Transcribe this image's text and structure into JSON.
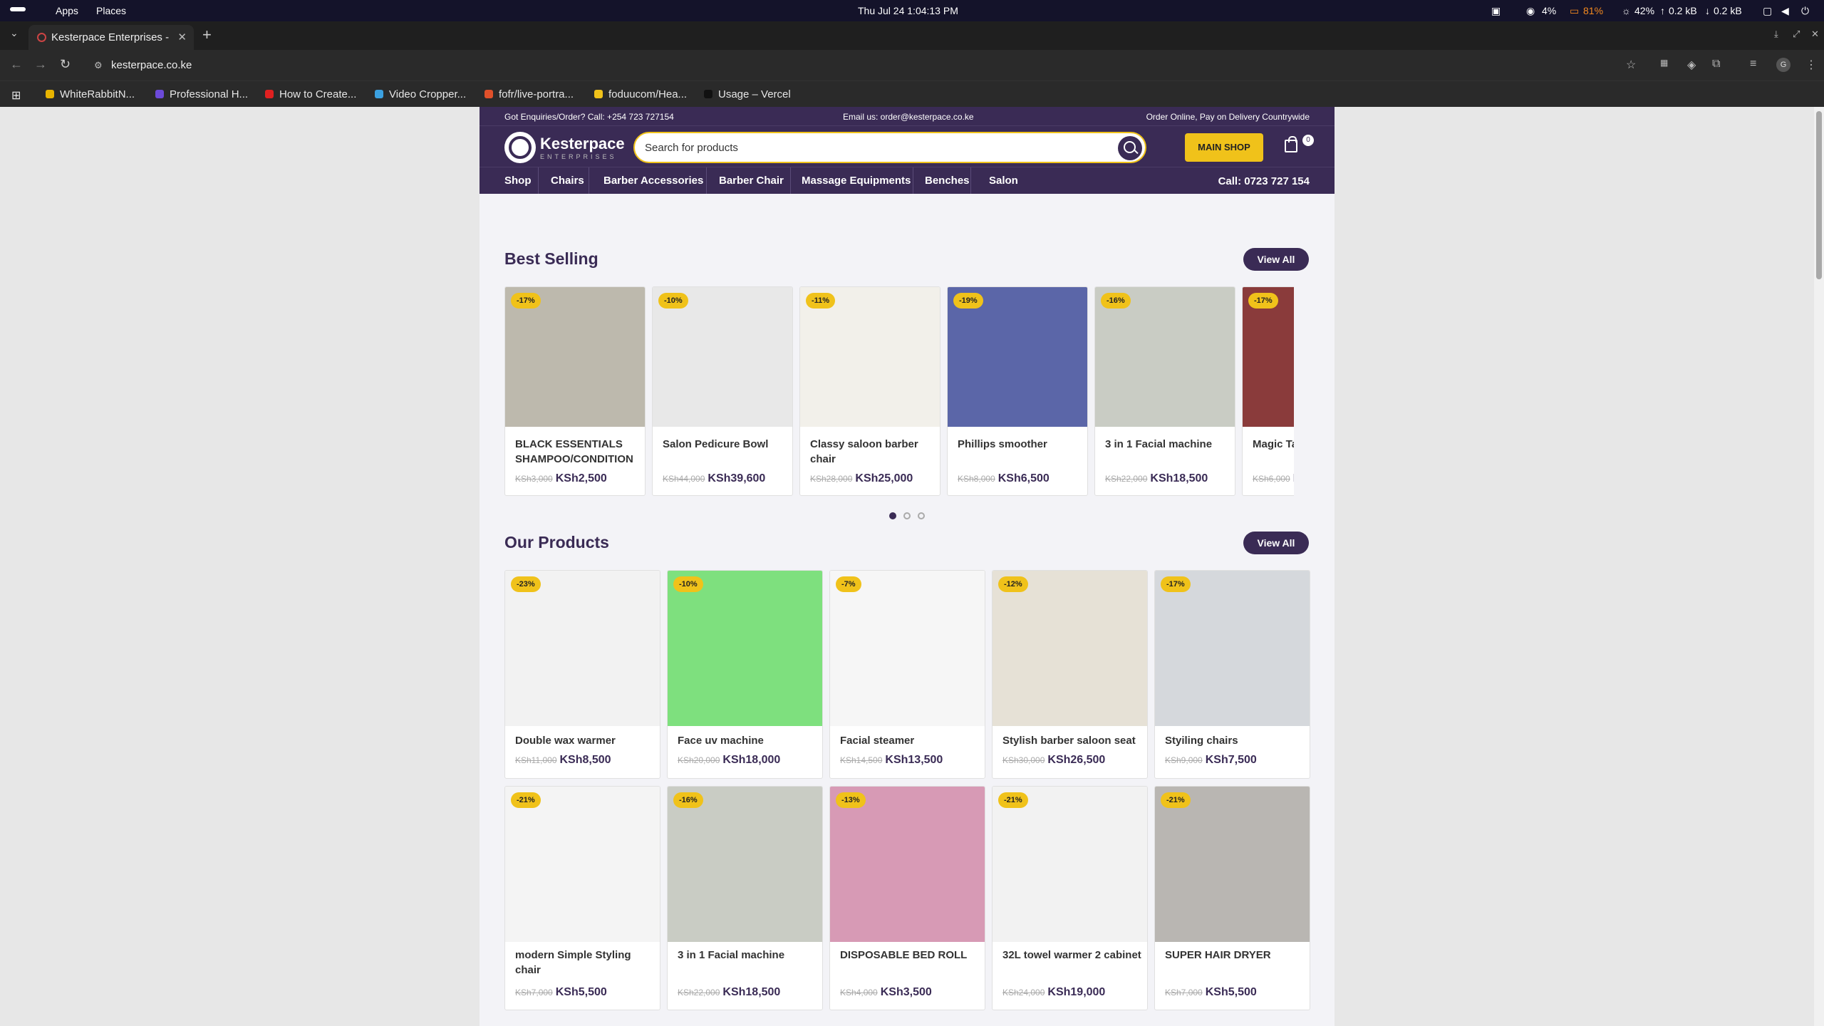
{
  "os": {
    "apps": "Apps",
    "places": "Places",
    "datetime": "Thu Jul 24   1:04:13 PM",
    "cpu": "4%",
    "battery": "81%",
    "brightness": "42%",
    "net_up": "0.2 kB",
    "net_down": "0.2 kB"
  },
  "browser": {
    "tab_title": "Kesterpace Enterprises -",
    "url": "kesterpace.co.ke",
    "avatar": "G",
    "bookmarks": [
      {
        "label": "WhiteRabbitN...",
        "color": "#e8b400"
      },
      {
        "label": "Professional H...",
        "color": "#6c4ad9"
      },
      {
        "label": "How to Create...",
        "color": "#e02020"
      },
      {
        "label": "Video Cropper...",
        "color": "#3ba0e0"
      },
      {
        "label": "fofr/live-portra...",
        "color": "#e0502a"
      },
      {
        "label": "foduucom/Hea...",
        "color": "#f0c21a"
      },
      {
        "label": "Usage – Vercel",
        "color": "#111111"
      }
    ]
  },
  "site": {
    "topbar": {
      "left": "Got Enquiries/Order? Call: +254 723 727154",
      "center": "Email us: order@kesterpace.co.ke",
      "right": "Order Online, Pay on Delivery Countrywide"
    },
    "logo": {
      "name": "Kesterpace",
      "sub": "ENTERPRISES"
    },
    "search_placeholder": "Search for products",
    "main_shop": "MAIN SHOP",
    "cart_count": "0",
    "menu": [
      "Shop",
      "Chairs",
      "Barber Accessories",
      "Barber Chair",
      "Massage Equipments",
      "Benches",
      "Salon"
    ],
    "call": "Call: 0723 727 154",
    "best_selling": {
      "title": "Best Selling",
      "view_all": "View All",
      "items": [
        {
          "badge": "-17%",
          "name": "BLACK ESSENTIALS SHAMPOO/CONDITION",
          "old": "KSh3,000",
          "price": "KSh2,500",
          "img": "#bdb9ad"
        },
        {
          "badge": "-10%",
          "name": "Salon Pedicure Bowl",
          "old": "KSh44,000",
          "price": "KSh39,600",
          "img": "#e8e8e8"
        },
        {
          "badge": "-11%",
          "name": "Classy saloon barber chair",
          "old": "KSh28,000",
          "price": "KSh25,000",
          "img": "#f2f0ea"
        },
        {
          "badge": "-19%",
          "name": "Phillips smoother",
          "old": "KSh8,000",
          "price": "KSh6,500",
          "img": "#5b66a8"
        },
        {
          "badge": "-16%",
          "name": "3 in 1 Facial machine",
          "old": "KSh22,000",
          "price": "KSh18,500",
          "img": "#c9ccc4"
        },
        {
          "badge": "-17%",
          "name": "Magic Taper",
          "old": "KSh6,000",
          "price": "KS",
          "img": "#8a3b3b"
        }
      ]
    },
    "our_products": {
      "title": "Our Products",
      "view_all": "View All",
      "row1": [
        {
          "badge": "-23%",
          "name": "Double wax warmer",
          "old": "KSh11,000",
          "price": "KSh8,500",
          "img": "#f2f2f2"
        },
        {
          "badge": "-10%",
          "name": "Face uv machine",
          "old": "KSh20,000",
          "price": "KSh18,000",
          "img": "#7ee07e"
        },
        {
          "badge": "-7%",
          "name": "Facial steamer",
          "old": "KSh14,500",
          "price": "KSh13,500",
          "img": "#f6f6f6"
        },
        {
          "badge": "-12%",
          "name": "Stylish barber saloon seat",
          "old": "KSh30,000",
          "price": "KSh26,500",
          "img": "#e6e1d6"
        },
        {
          "badge": "-17%",
          "name": "Styiling chairs",
          "old": "KSh9,000",
          "price": "KSh7,500",
          "img": "#d5d8dc"
        }
      ],
      "row2": [
        {
          "badge": "-21%",
          "name": "modern Simple Styling chair",
          "old": "KSh7,000",
          "price": "KSh5,500",
          "img": "#f4f4f4"
        },
        {
          "badge": "-16%",
          "name": "3 in 1 Facial machine",
          "old": "KSh22,000",
          "price": "KSh18,500",
          "img": "#c9ccc4"
        },
        {
          "badge": "-13%",
          "name": "DISPOSABLE BED ROLL",
          "old": "KSh4,000",
          "price": "KSh3,500",
          "img": "#d79ab5"
        },
        {
          "badge": "-21%",
          "name": "32L towel warmer 2 cabinet",
          "old": "KSh24,000",
          "price": "KSh19,000",
          "img": "#f2f2f2"
        },
        {
          "badge": "-21%",
          "name": "SUPER HAIR DRYER",
          "old": "KSh7,000",
          "price": "KSh5,500",
          "img": "#b9b6b2"
        }
      ]
    }
  }
}
